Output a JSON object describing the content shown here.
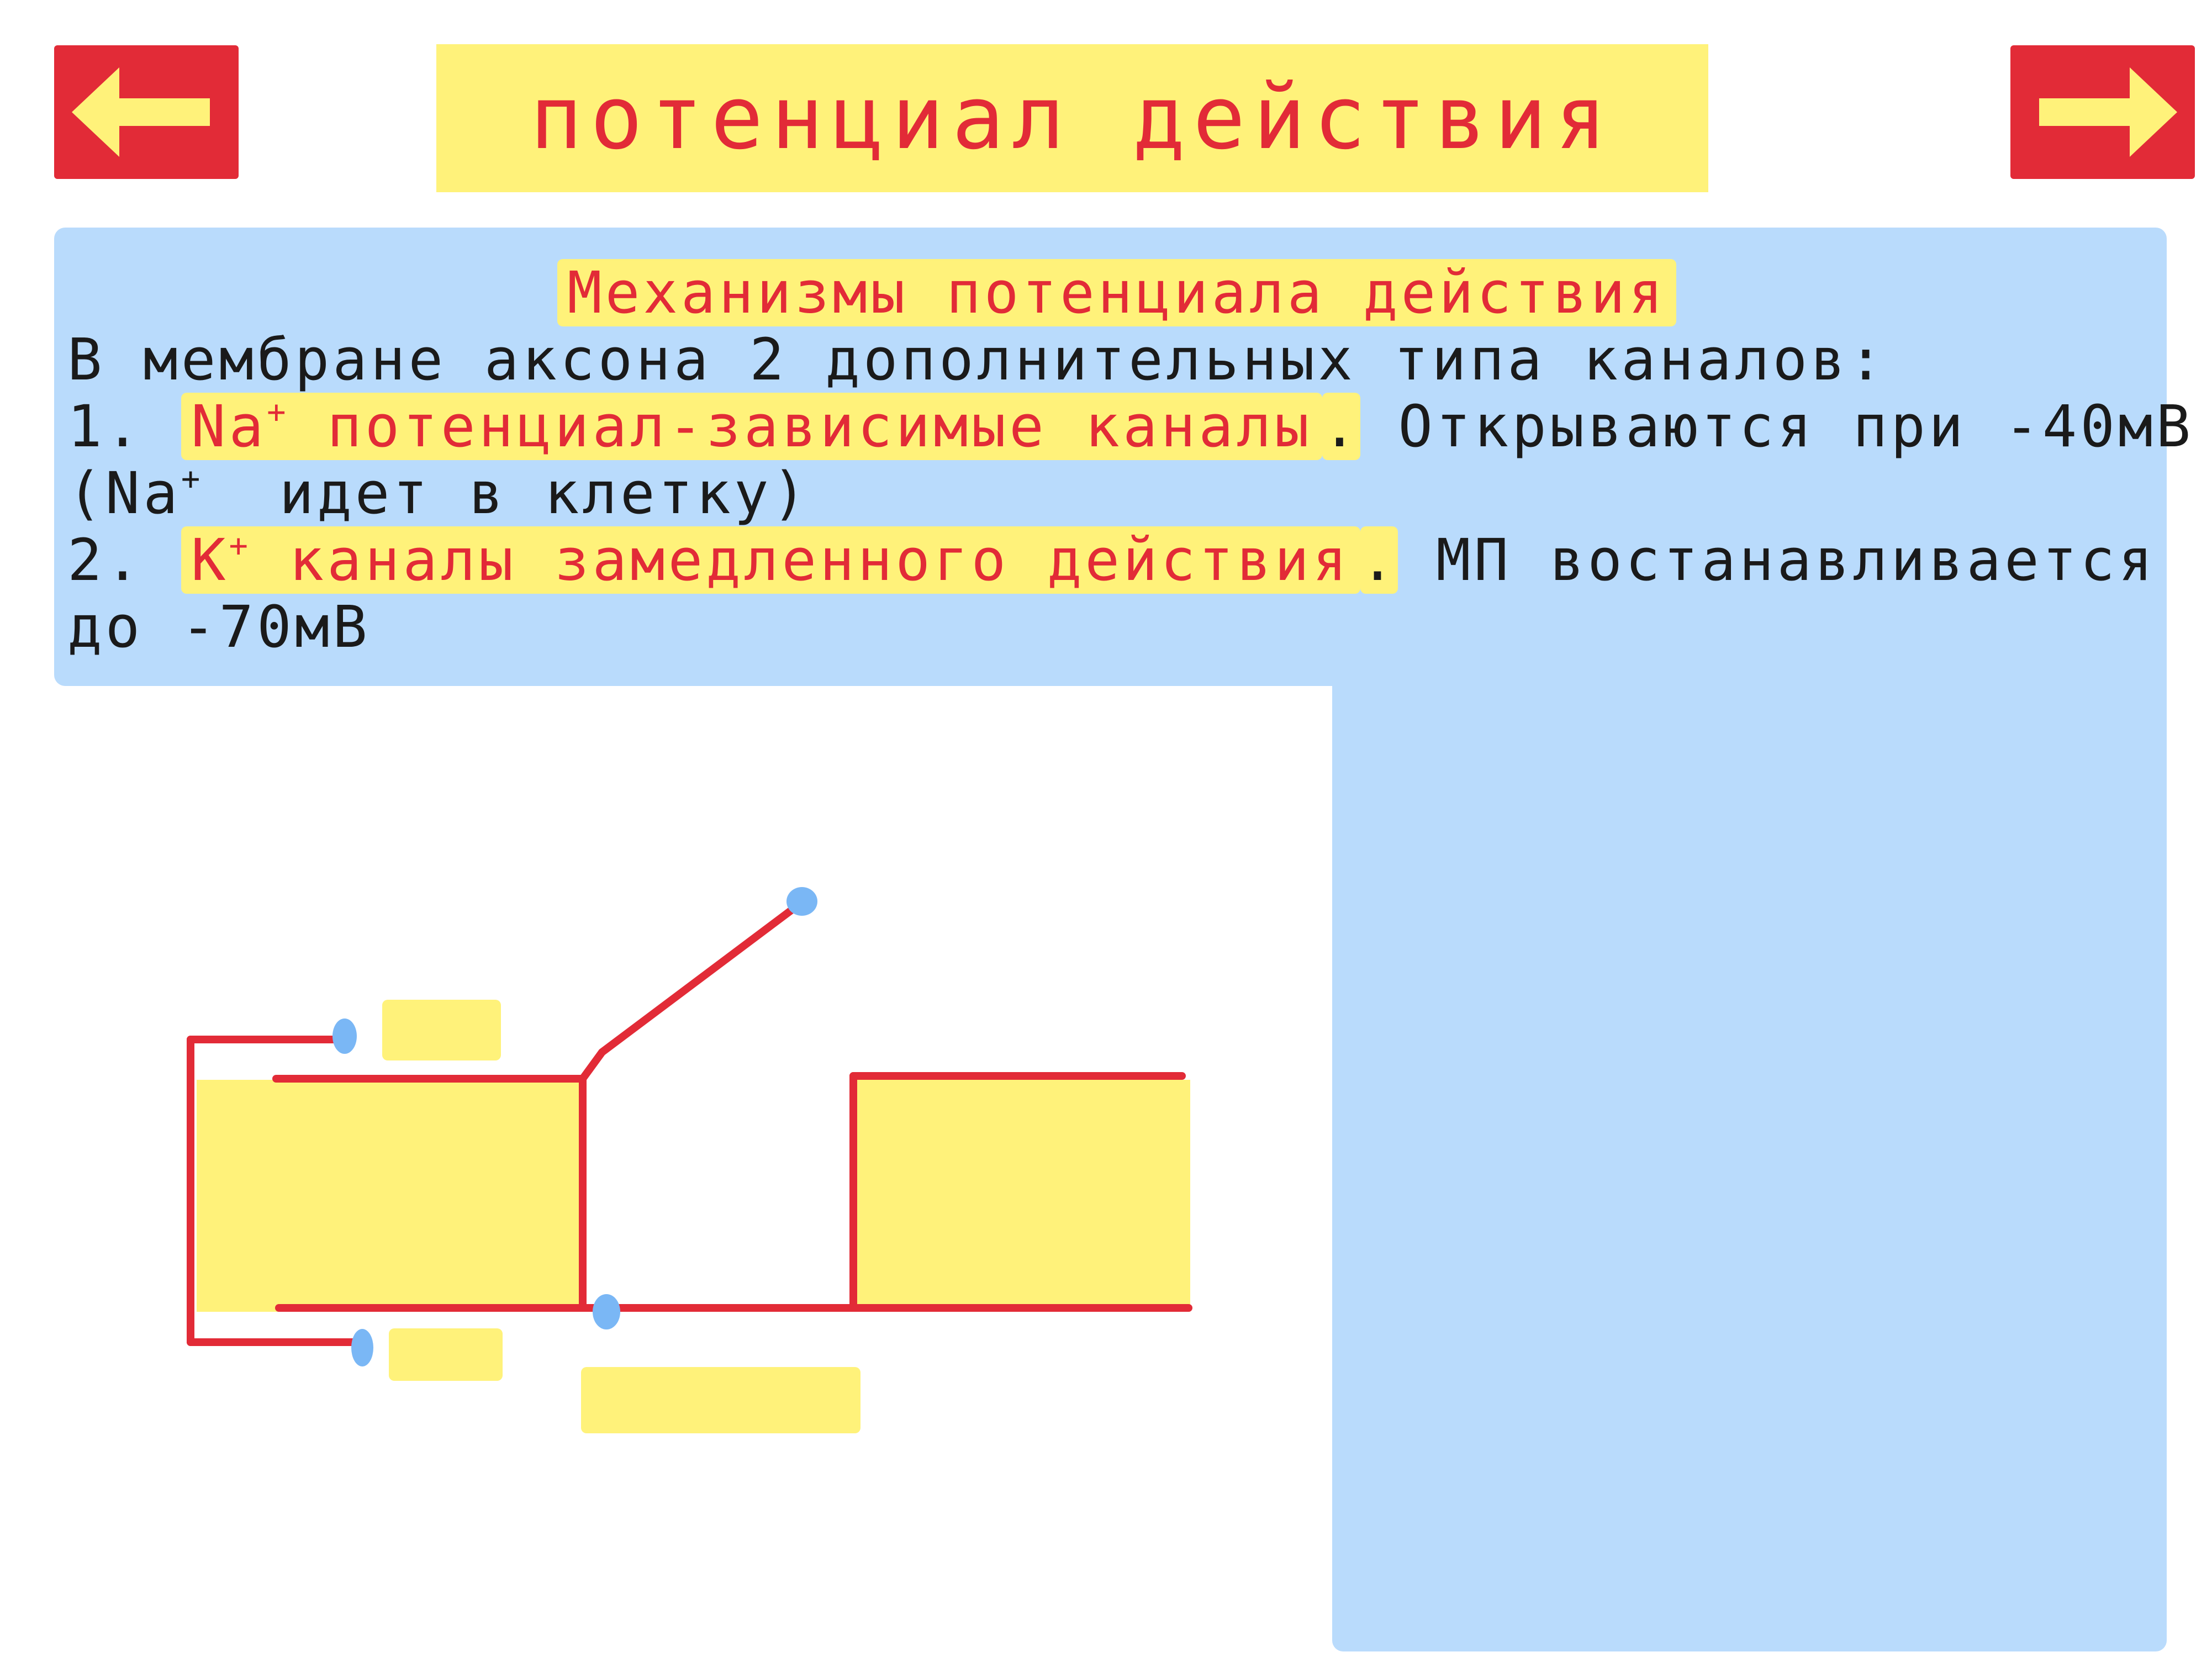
{
  "header": {
    "title": "потенциал действия",
    "prev_icon": "arrow-left-icon",
    "next_icon": "arrow-right-icon"
  },
  "content": {
    "subtitle": "Механизмы потенциала действия",
    "intro": "В мембране аксона 2 дополнительных типа каналов:",
    "item1_number": "1.",
    "item1_ion": "Na",
    "item1_ion_charge": "+",
    "item1_name": "потенциал-зависимые каналы",
    "item1_rest": "Открываются при -40мВ",
    "item1_line2_open": "(Na",
    "item1_line2_charge": "+",
    "item1_line2_rest": "идет в клетку)",
    "item2_number": "2.",
    "item2_ion": "K",
    "item2_ion_charge": "+",
    "item2_name": "каналы замедленного действия",
    "item2_rest": "МП востанавливается",
    "item2_line2": "до -70мВ"
  },
  "colors": {
    "red": "#e22b37",
    "yellow": "#fff27a",
    "blue": "#b9dbfc",
    "dot": "#7ab7f5",
    "text": "#1a1a1a"
  }
}
